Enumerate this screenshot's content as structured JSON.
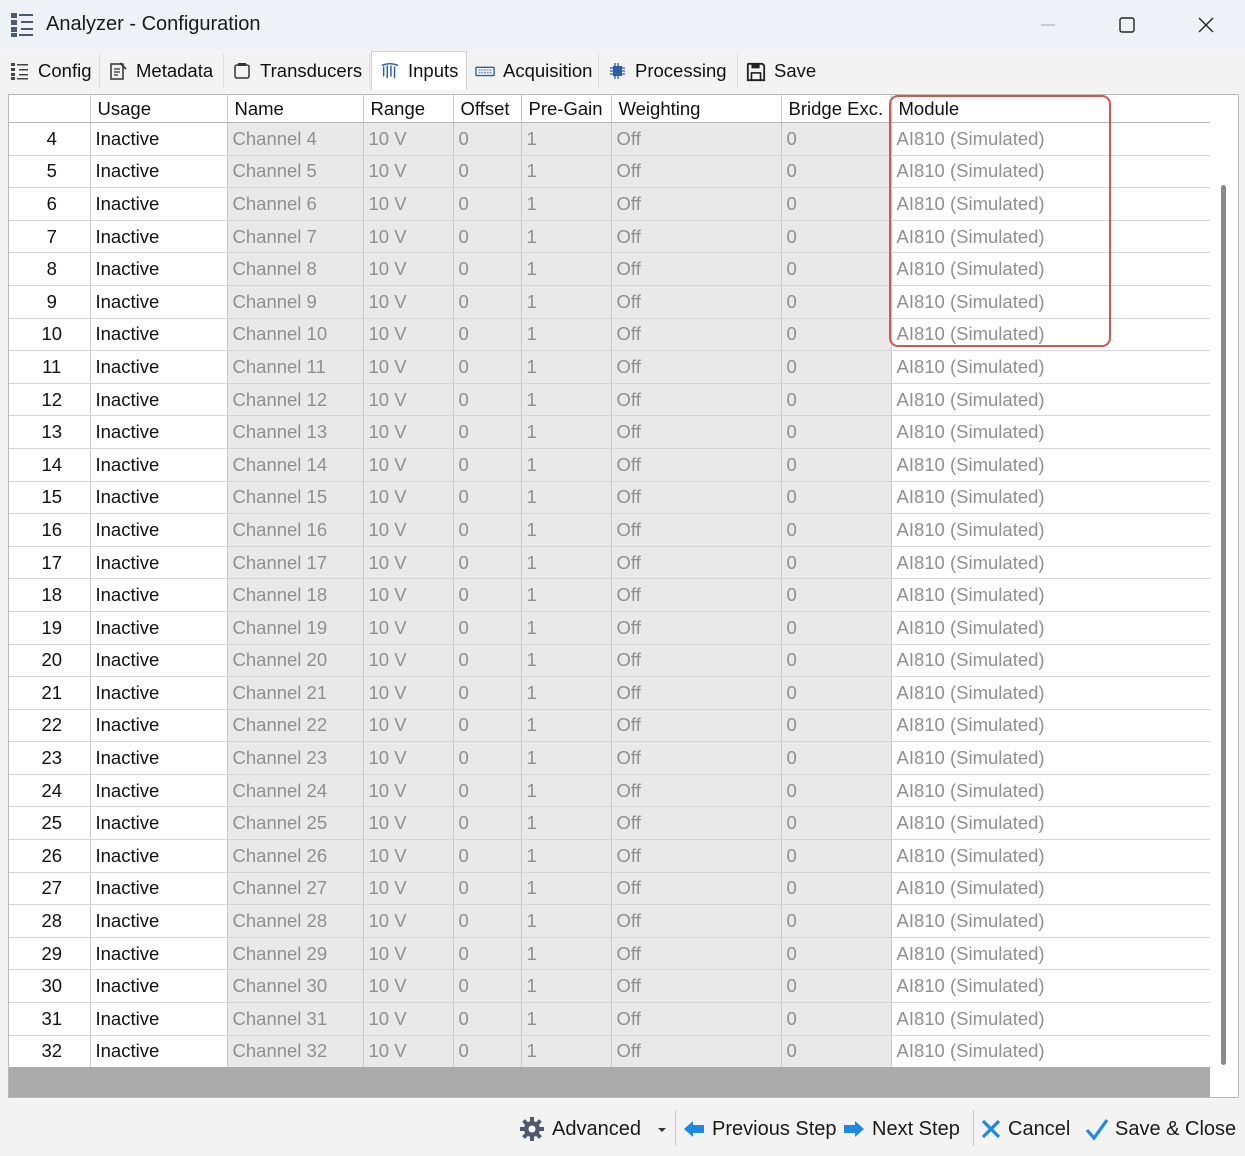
{
  "window": {
    "title": "Analyzer - Configuration",
    "controls": [
      "minimize",
      "maximize",
      "close"
    ]
  },
  "tabs": [
    {
      "label": "Config",
      "icon": "config-list-icon"
    },
    {
      "label": "Metadata",
      "icon": "metadata-icon"
    },
    {
      "label": "Transducers",
      "icon": "transducers-icon"
    },
    {
      "label": "Inputs",
      "icon": "inputs-icon",
      "active": true
    },
    {
      "label": "Acquisition",
      "icon": "acquisition-icon"
    },
    {
      "label": "Processing",
      "icon": "processing-chip-icon"
    },
    {
      "label": "Save",
      "icon": "save-icon"
    }
  ],
  "table": {
    "columns": [
      "",
      "Usage",
      "Name",
      "Range",
      "Offset",
      "Pre-Gain",
      "Weighting",
      "Bridge Exc.",
      "Module"
    ],
    "rows": [
      {
        "index": "4",
        "usage": "Inactive",
        "name": "Channel 4",
        "range": "10 V",
        "offset": "0",
        "pregain": "1",
        "weighting": "Off",
        "bridge": "0",
        "module": "AI810 (Simulated)"
      },
      {
        "index": "5",
        "usage": "Inactive",
        "name": "Channel 5",
        "range": "10 V",
        "offset": "0",
        "pregain": "1",
        "weighting": "Off",
        "bridge": "0",
        "module": "AI810 (Simulated)"
      },
      {
        "index": "6",
        "usage": "Inactive",
        "name": "Channel 6",
        "range": "10 V",
        "offset": "0",
        "pregain": "1",
        "weighting": "Off",
        "bridge": "0",
        "module": "AI810 (Simulated)"
      },
      {
        "index": "7",
        "usage": "Inactive",
        "name": "Channel 7",
        "range": "10 V",
        "offset": "0",
        "pregain": "1",
        "weighting": "Off",
        "bridge": "0",
        "module": "AI810 (Simulated)"
      },
      {
        "index": "8",
        "usage": "Inactive",
        "name": "Channel 8",
        "range": "10 V",
        "offset": "0",
        "pregain": "1",
        "weighting": "Off",
        "bridge": "0",
        "module": "AI810 (Simulated)"
      },
      {
        "index": "9",
        "usage": "Inactive",
        "name": "Channel 9",
        "range": "10 V",
        "offset": "0",
        "pregain": "1",
        "weighting": "Off",
        "bridge": "0",
        "module": "AI810 (Simulated)"
      },
      {
        "index": "10",
        "usage": "Inactive",
        "name": "Channel 10",
        "range": "10 V",
        "offset": "0",
        "pregain": "1",
        "weighting": "Off",
        "bridge": "0",
        "module": "AI810 (Simulated)"
      },
      {
        "index": "11",
        "usage": "Inactive",
        "name": "Channel 11",
        "range": "10 V",
        "offset": "0",
        "pregain": "1",
        "weighting": "Off",
        "bridge": "0",
        "module": "AI810 (Simulated)"
      },
      {
        "index": "12",
        "usage": "Inactive",
        "name": "Channel 12",
        "range": "10 V",
        "offset": "0",
        "pregain": "1",
        "weighting": "Off",
        "bridge": "0",
        "module": "AI810 (Simulated)"
      },
      {
        "index": "13",
        "usage": "Inactive",
        "name": "Channel 13",
        "range": "10 V",
        "offset": "0",
        "pregain": "1",
        "weighting": "Off",
        "bridge": "0",
        "module": "AI810 (Simulated)"
      },
      {
        "index": "14",
        "usage": "Inactive",
        "name": "Channel 14",
        "range": "10 V",
        "offset": "0",
        "pregain": "1",
        "weighting": "Off",
        "bridge": "0",
        "module": "AI810 (Simulated)"
      },
      {
        "index": "15",
        "usage": "Inactive",
        "name": "Channel 15",
        "range": "10 V",
        "offset": "0",
        "pregain": "1",
        "weighting": "Off",
        "bridge": "0",
        "module": "AI810 (Simulated)"
      },
      {
        "index": "16",
        "usage": "Inactive",
        "name": "Channel 16",
        "range": "10 V",
        "offset": "0",
        "pregain": "1",
        "weighting": "Off",
        "bridge": "0",
        "module": "AI810 (Simulated)"
      },
      {
        "index": "17",
        "usage": "Inactive",
        "name": "Channel 17",
        "range": "10 V",
        "offset": "0",
        "pregain": "1",
        "weighting": "Off",
        "bridge": "0",
        "module": "AI810 (Simulated)"
      },
      {
        "index": "18",
        "usage": "Inactive",
        "name": "Channel 18",
        "range": "10 V",
        "offset": "0",
        "pregain": "1",
        "weighting": "Off",
        "bridge": "0",
        "module": "AI810 (Simulated)"
      },
      {
        "index": "19",
        "usage": "Inactive",
        "name": "Channel 19",
        "range": "10 V",
        "offset": "0",
        "pregain": "1",
        "weighting": "Off",
        "bridge": "0",
        "module": "AI810 (Simulated)"
      },
      {
        "index": "20",
        "usage": "Inactive",
        "name": "Channel 20",
        "range": "10 V",
        "offset": "0",
        "pregain": "1",
        "weighting": "Off",
        "bridge": "0",
        "module": "AI810 (Simulated)"
      },
      {
        "index": "21",
        "usage": "Inactive",
        "name": "Channel 21",
        "range": "10 V",
        "offset": "0",
        "pregain": "1",
        "weighting": "Off",
        "bridge": "0",
        "module": "AI810 (Simulated)"
      },
      {
        "index": "22",
        "usage": "Inactive",
        "name": "Channel 22",
        "range": "10 V",
        "offset": "0",
        "pregain": "1",
        "weighting": "Off",
        "bridge": "0",
        "module": "AI810 (Simulated)"
      },
      {
        "index": "23",
        "usage": "Inactive",
        "name": "Channel 23",
        "range": "10 V",
        "offset": "0",
        "pregain": "1",
        "weighting": "Off",
        "bridge": "0",
        "module": "AI810 (Simulated)"
      },
      {
        "index": "24",
        "usage": "Inactive",
        "name": "Channel 24",
        "range": "10 V",
        "offset": "0",
        "pregain": "1",
        "weighting": "Off",
        "bridge": "0",
        "module": "AI810 (Simulated)"
      },
      {
        "index": "25",
        "usage": "Inactive",
        "name": "Channel 25",
        "range": "10 V",
        "offset": "0",
        "pregain": "1",
        "weighting": "Off",
        "bridge": "0",
        "module": "AI810 (Simulated)"
      },
      {
        "index": "26",
        "usage": "Inactive",
        "name": "Channel 26",
        "range": "10 V",
        "offset": "0",
        "pregain": "1",
        "weighting": "Off",
        "bridge": "0",
        "module": "AI810 (Simulated)"
      },
      {
        "index": "27",
        "usage": "Inactive",
        "name": "Channel 27",
        "range": "10 V",
        "offset": "0",
        "pregain": "1",
        "weighting": "Off",
        "bridge": "0",
        "module": "AI810 (Simulated)"
      },
      {
        "index": "28",
        "usage": "Inactive",
        "name": "Channel 28",
        "range": "10 V",
        "offset": "0",
        "pregain": "1",
        "weighting": "Off",
        "bridge": "0",
        "module": "AI810 (Simulated)"
      },
      {
        "index": "29",
        "usage": "Inactive",
        "name": "Channel 29",
        "range": "10 V",
        "offset": "0",
        "pregain": "1",
        "weighting": "Off",
        "bridge": "0",
        "module": "AI810 (Simulated)"
      },
      {
        "index": "30",
        "usage": "Inactive",
        "name": "Channel 30",
        "range": "10 V",
        "offset": "0",
        "pregain": "1",
        "weighting": "Off",
        "bridge": "0",
        "module": "AI810 (Simulated)"
      },
      {
        "index": "31",
        "usage": "Inactive",
        "name": "Channel 31",
        "range": "10 V",
        "offset": "0",
        "pregain": "1",
        "weighting": "Off",
        "bridge": "0",
        "module": "AI810 (Simulated)"
      },
      {
        "index": "32",
        "usage": "Inactive",
        "name": "Channel 32",
        "range": "10 V",
        "offset": "0",
        "pregain": "1",
        "weighting": "Off",
        "bridge": "0",
        "module": "AI810 (Simulated)"
      }
    ]
  },
  "highlight": {
    "color": "#d9534f"
  },
  "footer": {
    "advanced_label": "Advanced",
    "previous_label": "Previous Step",
    "next_label": "Next Step",
    "cancel_label": "Cancel",
    "save_close_label": "Save & Close"
  },
  "colors": {
    "accent_blue": "#1e88e5",
    "cancel_blue": "#1e88e5",
    "check_blue": "#1e88e5"
  }
}
